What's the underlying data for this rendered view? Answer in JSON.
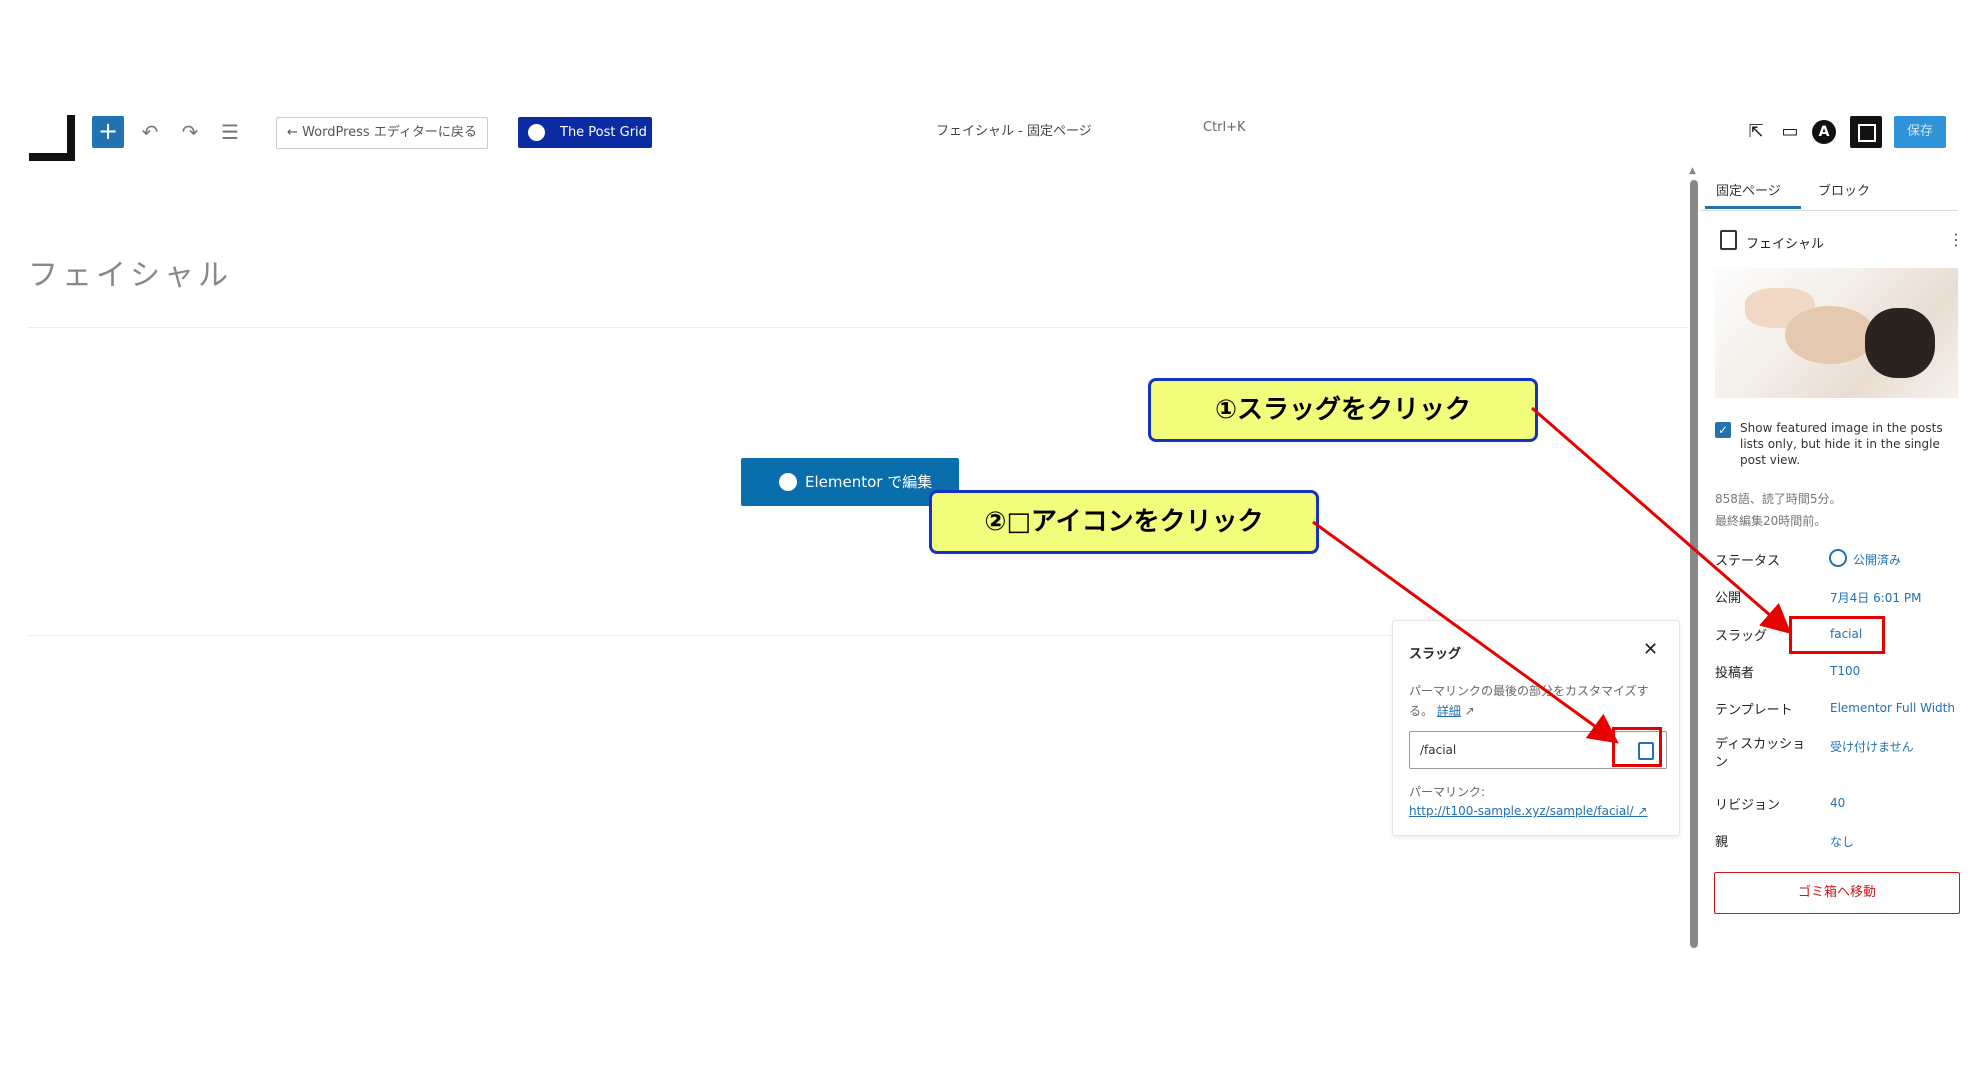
{
  "toolbar": {
    "back_label": "← WordPress エディターに戻る",
    "post_grid_label": "The Post Grid",
    "document_title": "フェイシャル - 固定ページ",
    "shortcut": "Ctrl+K",
    "save_label": "保存"
  },
  "content": {
    "page_title": "フェイシャル",
    "elementor_button": "Elementor で編集"
  },
  "sidebar": {
    "tabs": [
      "固定ページ",
      "ブロック"
    ],
    "doc_title": "フェイシャル",
    "featured_checkbox_label": "Show featured image in the posts lists only, but hide it in the single post view.",
    "word_count": "858語、読了時間5分。",
    "last_edited": "最終編集20時間前。",
    "rows": [
      {
        "label": "ステータス",
        "value": "公開済み"
      },
      {
        "label": "公開",
        "value": "7月4日 6:01 PM"
      },
      {
        "label": "スラッグ",
        "value": "facial"
      },
      {
        "label": "投稿者",
        "value": "T100"
      },
      {
        "label": "テンプレート",
        "value": "Elementor Full Width"
      },
      {
        "label": "ディスカッション",
        "value": "受け付けません"
      },
      {
        "label": "リビジョン",
        "value": "40"
      },
      {
        "label": "親",
        "value": "なし"
      }
    ],
    "trash_label": "ゴミ箱へ移動"
  },
  "slug_popover": {
    "title": "スラッグ",
    "help_text": "パーマリンクの最後の部分をカスタマイズする。",
    "help_link": "詳細",
    "input_value": "/facial",
    "permalink_label": "パーマリンク:",
    "permalink_url": "http://t100-sample.xyz/sample/facial/"
  },
  "annotations": {
    "callout1": "①スラッグをクリック",
    "callout2": "②□アイコンをクリック"
  },
  "colors": {
    "accent": "#2271b1",
    "post_grid": "#0b2ba3",
    "callout_bg": "#f2fd7c",
    "callout_border": "#1532c7",
    "highlight": "#e60000"
  }
}
